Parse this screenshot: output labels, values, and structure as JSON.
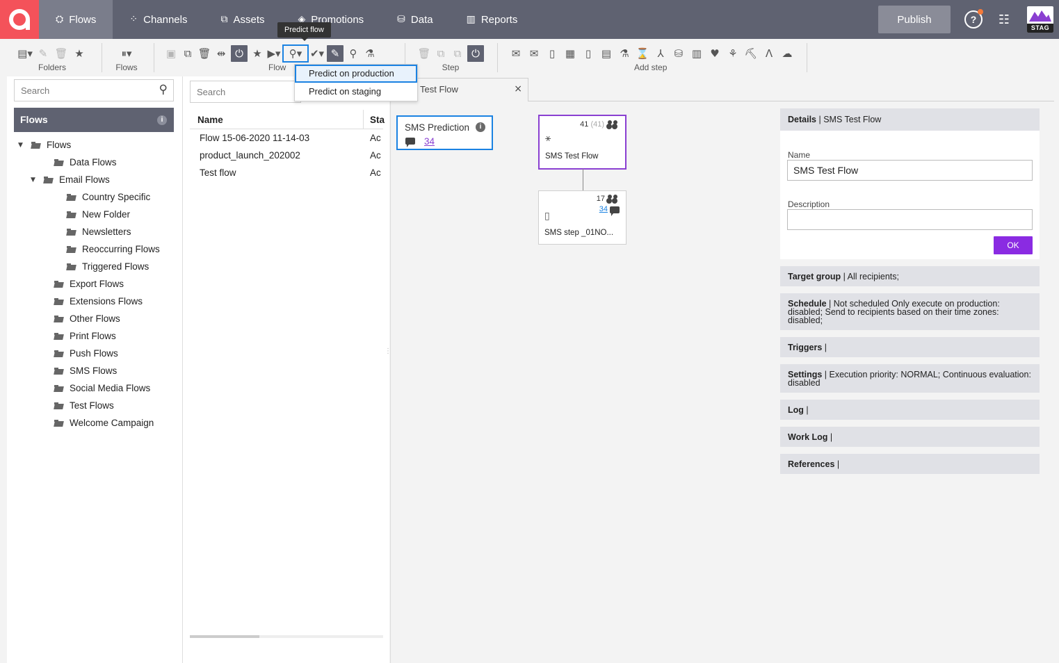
{
  "nav": {
    "items": [
      {
        "label": "Flows",
        "icon": "flows-icon",
        "glyph": "⛭"
      },
      {
        "label": "Channels",
        "icon": "channels-icon",
        "glyph": "⁘"
      },
      {
        "label": "Assets",
        "icon": "assets-icon",
        "glyph": "⧉"
      },
      {
        "label": "Promotions",
        "icon": "promotions-icon",
        "glyph": "◈"
      },
      {
        "label": "Data",
        "icon": "data-icon",
        "glyph": "⛁"
      },
      {
        "label": "Reports",
        "icon": "reports-icon",
        "glyph": "▥"
      }
    ],
    "publish": "Publish",
    "help": "?",
    "sliders": "☷",
    "env_badge": "STAG"
  },
  "toolbar": {
    "folders_label": "Folders",
    "flows_label": "Flows",
    "flow_label": "Flow",
    "step_label": "Step",
    "add_step_label": "Add step",
    "tooltip": "Predict flow",
    "dropdown": [
      "Predict on production",
      "Predict on staging"
    ]
  },
  "left": {
    "search_placeholder": "Search",
    "header": "Flows",
    "info": "i",
    "tree": [
      {
        "label": "Flows",
        "level": 0,
        "expanded": true
      },
      {
        "label": "Data Flows",
        "level": 1
      },
      {
        "label": "Email Flows",
        "level": 1,
        "expanded": true
      },
      {
        "label": "Country Specific",
        "level": 2
      },
      {
        "label": "New Folder",
        "level": 2
      },
      {
        "label": "Newsletters",
        "level": 2
      },
      {
        "label": "Reoccurring Flows",
        "level": 2
      },
      {
        "label": "Triggered Flows",
        "level": 2
      },
      {
        "label": "Export Flows",
        "level": 1
      },
      {
        "label": "Extensions Flows",
        "level": 1
      },
      {
        "label": "Other Flows",
        "level": 1
      },
      {
        "label": "Print Flows",
        "level": 1
      },
      {
        "label": "Push Flows",
        "level": 1
      },
      {
        "label": "SMS Flows",
        "level": 1
      },
      {
        "label": "Social Media Flows",
        "level": 1
      },
      {
        "label": "Test Flows",
        "level": 1
      },
      {
        "label": "Welcome Campaign",
        "level": 1
      }
    ]
  },
  "middle": {
    "search_placeholder": "Search",
    "col_name": "Name",
    "col_status": "Sta",
    "rows": [
      {
        "name": "Flow 15-06-2020 11-14-03",
        "status": "Ac"
      },
      {
        "name": "product_launch_202002",
        "status": "Ac"
      },
      {
        "name": "Test flow",
        "status": "Ac"
      }
    ]
  },
  "editor": {
    "tab_label": "Test Flow",
    "tab_close": "×",
    "prediction_title": "SMS Prediction",
    "prediction_info": "i",
    "prediction_value": "34",
    "node1": {
      "count": "41",
      "count_total": "(41)",
      "label": "SMS Test Flow"
    },
    "node2": {
      "count": "17",
      "link": "34",
      "label": "SMS step _01NO..."
    }
  },
  "details": {
    "header_bold": "Details",
    "header_rest": " | SMS Test Flow",
    "name_label": "Name",
    "name_value": "SMS Test Flow",
    "desc_label": "Description",
    "desc_value": "",
    "ok": "OK",
    "sections": [
      {
        "title": "Target group",
        "text": " | All recipients;"
      },
      {
        "title": "Schedule",
        "text": " | Not scheduled Only execute on production: disabled; Send to recipients based on their time zones: disabled;"
      },
      {
        "title": "Triggers",
        "text": " |"
      },
      {
        "title": "Settings",
        "text": " | Execution priority: NORMAL; Continuous evaluation: disabled"
      },
      {
        "title": "Log",
        "text": " |"
      },
      {
        "title": "Work Log",
        "text": " |"
      },
      {
        "title": "References",
        "text": " |"
      }
    ]
  },
  "colors": {
    "accent": "#8a2be2",
    "nav": "#5f6271",
    "highlight": "#1a82e2",
    "logo": "#f4525a"
  }
}
